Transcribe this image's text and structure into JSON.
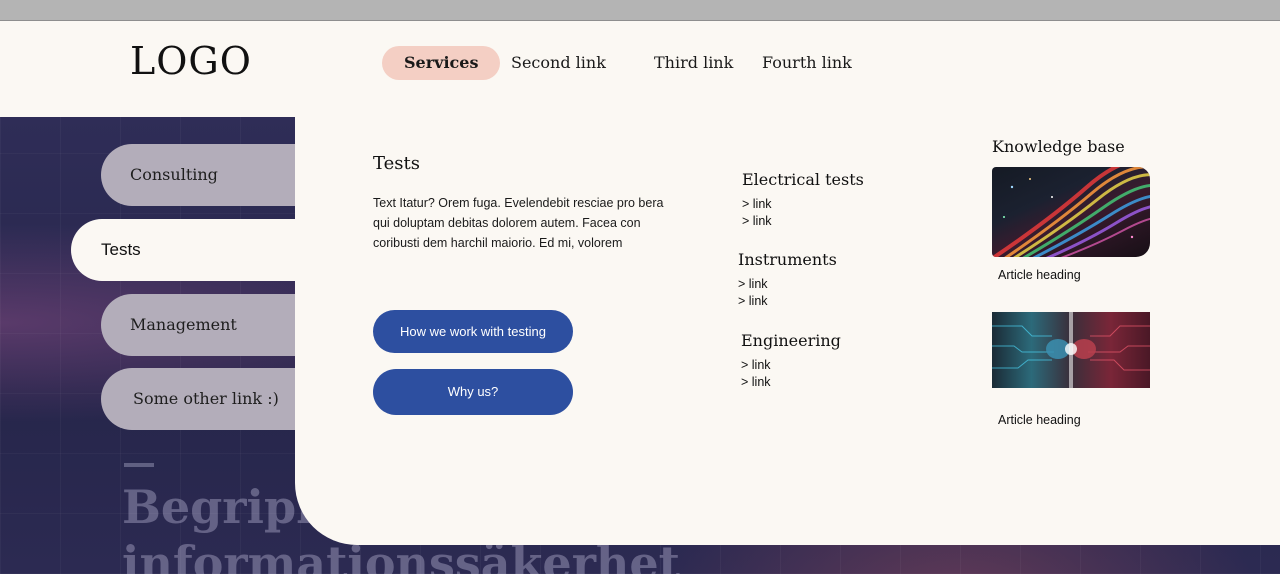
{
  "header": {
    "logo": "LOGO",
    "nav": [
      {
        "label": "Services"
      },
      {
        "label": "Second link"
      },
      {
        "label": "Third link"
      },
      {
        "label": "Fourth link"
      }
    ]
  },
  "sidebar": {
    "items": [
      {
        "label": "Consulting"
      },
      {
        "label": "Tests"
      },
      {
        "label": "Management"
      },
      {
        "label": "Some other link :)"
      }
    ]
  },
  "hero": {
    "title_line1": "Begriplig",
    "title_line2": "informationssäkerhet"
  },
  "panel": {
    "title": "Tests",
    "text": "Text Itatur? Orem fuga. Evelendebit resciae pro bera qui doluptam debitas dolorem autem. Facea con coribusti dem harchil maiorio. Ed mi, volorem",
    "buttons": [
      {
        "label": "How we work with testing"
      },
      {
        "label": "Why us?"
      }
    ],
    "categories": [
      {
        "title": "Electrical tests",
        "links": [
          "> link",
          "> link"
        ]
      },
      {
        "title": "Instruments",
        "links": [
          "> link",
          "> link"
        ]
      },
      {
        "title": "Engineering",
        "links": [
          "> link",
          "> link"
        ]
      }
    ],
    "knowledge_base": {
      "title": "Knowledge base",
      "articles": [
        {
          "heading": "Article heading",
          "image": "colorful-light-streams-image"
        },
        {
          "heading": "Article heading",
          "image": "circuit-fists-image"
        }
      ]
    }
  },
  "colors": {
    "accent_button": "#2d4fa0",
    "nav_active_pill": "#f4cfc4",
    "sidebar_pill": "#b3adba",
    "hero_background": "#2a2850",
    "panel_background": "#fbf8f3"
  }
}
